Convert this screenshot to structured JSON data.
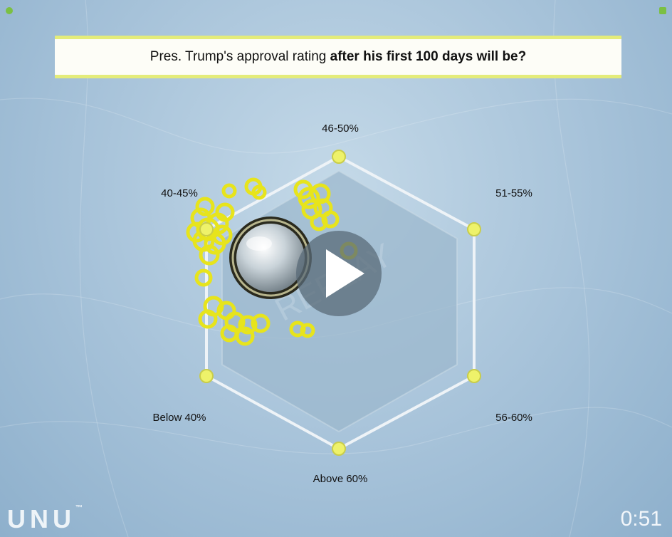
{
  "question": {
    "part_normal": "Pres. Trump's approval rating ",
    "part_bold": "after his first 100 days will be?"
  },
  "answers": {
    "top": "46-50%",
    "upper_right": "51-55%",
    "lower_right": "56-60%",
    "bottom": "Above 60%",
    "lower_left": "Below 40%",
    "upper_left": "40-45%"
  },
  "watermark_text": "REPLAY",
  "brand": {
    "logo": "UNU",
    "tm": "™"
  },
  "timer": "0:51",
  "colors": {
    "accent_yellow": "#e4ec7a",
    "swarm_yellow": "#e7e41c",
    "node_yellow": "#eef26a",
    "hex_fill": "#9ab7cc",
    "frame": "#eef3f7",
    "corner_green": "#7bc043"
  },
  "icons": {
    "play": "play-icon",
    "puck": "puck-magnifier-icon"
  }
}
